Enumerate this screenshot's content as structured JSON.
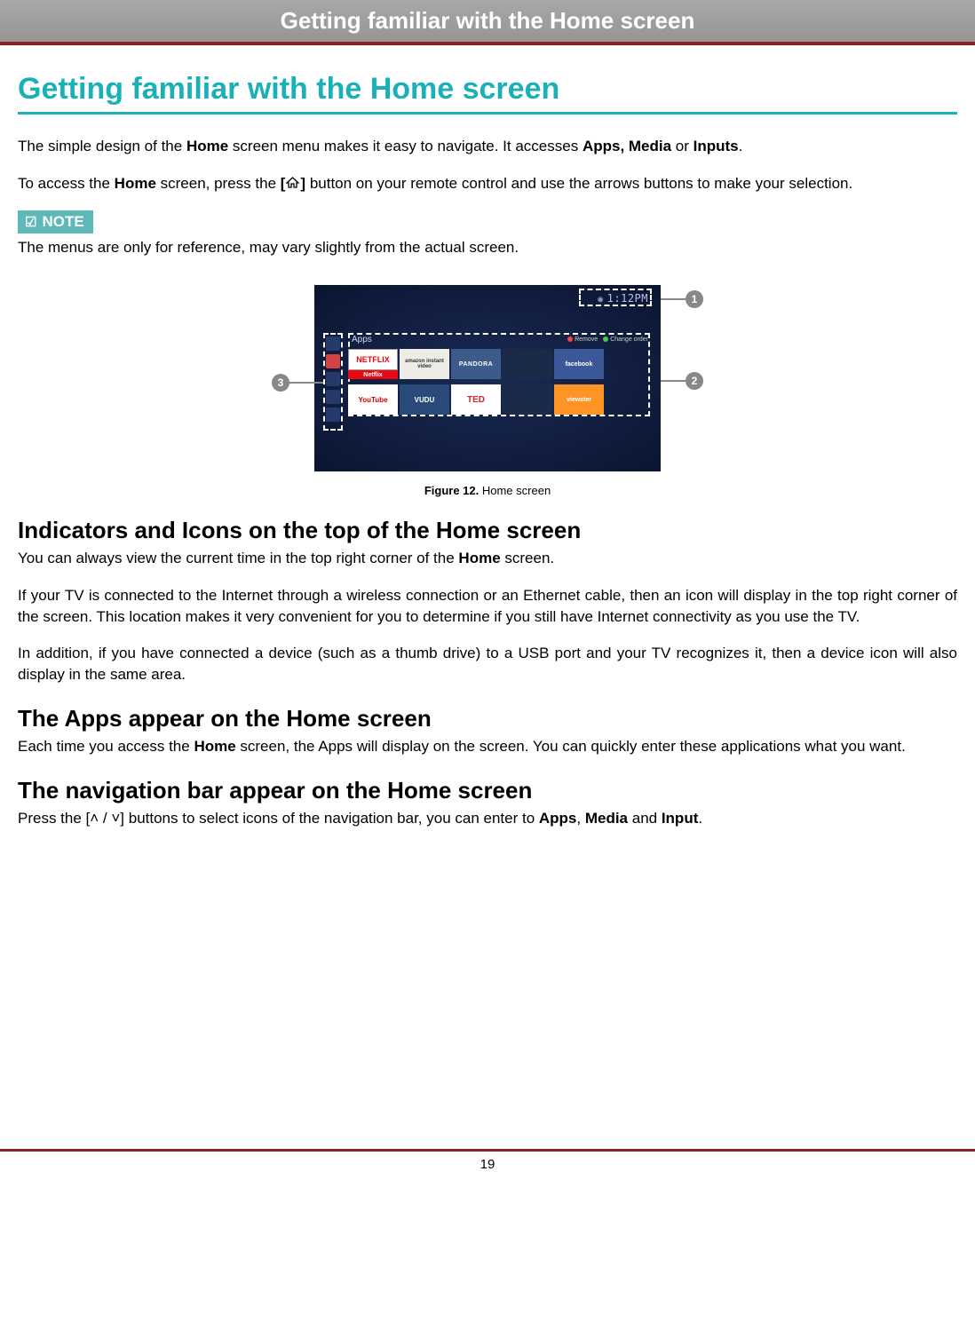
{
  "header": {
    "title": "Getting familiar with the Home screen"
  },
  "section": {
    "title": "Getting familiar with the Home screen"
  },
  "intro": {
    "p1_pre": "The simple design of the ",
    "p1_b1": "Home",
    "p1_mid1": " screen menu makes it easy to navigate. It accesses ",
    "p1_b2": "Apps, Media",
    "p1_mid2": " or ",
    "p1_b3": "Inputs",
    "p1_end": ".",
    "p2_pre": "To access the ",
    "p2_b1": "Home",
    "p2_mid1": " screen, press the ",
    "p2_bracket_open": "[",
    "p2_bracket_close": "]",
    "p2_end": " button on your remote control and use the arrows buttons to make your selection."
  },
  "note": {
    "label": "NOTE",
    "text": "The menus are only for reference, may vary slightly from the actual screen."
  },
  "figure": {
    "time": "1:12PM",
    "apps_label": "Apps",
    "caption_bold": "Figure 12.",
    "caption_rest": " Home screen",
    "row1": [
      "NETFLIX",
      "amazon instant video",
      "PANDORA",
      "",
      "facebook"
    ],
    "netflix_sub": "Netflix",
    "row2": [
      "YouTube",
      "VUDU",
      "TED",
      "",
      "viewster"
    ],
    "controls": {
      "remove": "Remove",
      "change": "Change order"
    },
    "callouts": {
      "c1": "1",
      "c2": "2",
      "c3": "3"
    }
  },
  "sections": {
    "indicators": {
      "heading": "Indicators and Icons on the top of the Home screen",
      "p1_pre": "You can always view the current time in the top right corner of the ",
      "p1_b": "Home",
      "p1_end": " screen.",
      "p2": "If your TV is connected to the Internet through a wireless connection or an Ethernet cable, then an icon will display in the top right corner of the screen. This location makes it very convenient for you to determine if you still have Internet connectivity as you use the TV.",
      "p3": "In addition, if you have connected a device (such as a thumb drive) to a USB port and your TV recognizes it, then a device icon will also display in the same area."
    },
    "apps": {
      "heading": "The Apps appear on the Home screen",
      "p1_pre": "Each time you access the ",
      "p1_b": "Home",
      "p1_end": " screen, the Apps will display on the screen. You can quickly enter these applications what you want."
    },
    "nav": {
      "heading": "The navigation bar appear on the Home screen",
      "p1_pre": "Press the [",
      "p1_btn": "˄ / ˅",
      "p1_mid": "] buttons to select icons of the navigation bar, you can enter to ",
      "p1_b1": "Apps",
      "p1_s1": ", ",
      "p1_b2": "Media",
      "p1_s2": " and ",
      "p1_b3": "Input",
      "p1_end": "."
    }
  },
  "page_number": "19"
}
